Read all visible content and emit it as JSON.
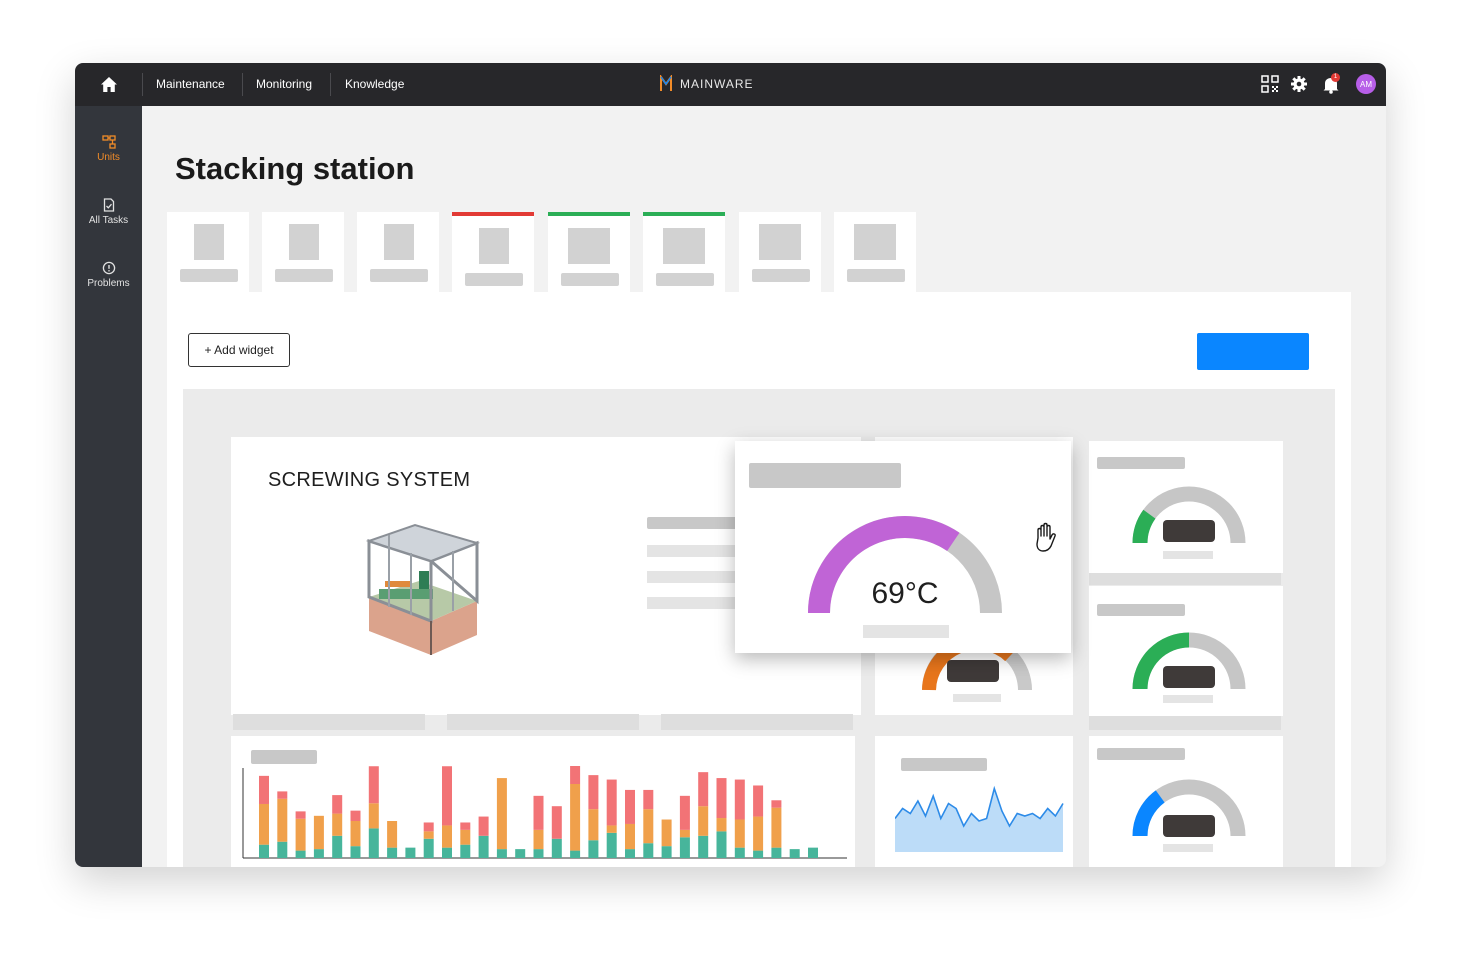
{
  "topbar": {
    "nav": [
      "Maintenance",
      "Monitoring",
      "Knowledge"
    ],
    "brand": "MAINWARE",
    "avatar_initials": "AM",
    "notification_count": "1",
    "icons": [
      "home-icon",
      "qr-code-icon",
      "gear-icon",
      "bell-icon"
    ]
  },
  "sidebar": {
    "items": [
      {
        "label": "Units",
        "icon": "units-icon",
        "active": true
      },
      {
        "label": "All Tasks",
        "icon": "task-file-icon",
        "active": false
      },
      {
        "label": "Problems",
        "icon": "alert-circle-icon",
        "active": false
      }
    ]
  },
  "page": {
    "title": "Stacking station",
    "add_widget_label": "+ Add widget",
    "tabs": [
      {
        "status": "none"
      },
      {
        "status": "none"
      },
      {
        "status": "none"
      },
      {
        "status": "error"
      },
      {
        "status": "ok"
      },
      {
        "status": "ok"
      },
      {
        "status": "none"
      },
      {
        "status": "none"
      }
    ]
  },
  "widgets": {
    "system_name": "SCREWING SYSTEM",
    "temperature_value": "69°C",
    "temperature_fraction": 0.69,
    "cursor": "grab-hand-icon",
    "small_gauges": [
      {
        "fraction": 0.2,
        "color": "#2bae56"
      },
      {
        "fraction": 0.5,
        "color": "#2bae56"
      },
      {
        "fraction": 0.3,
        "color": "#0a86ff"
      }
    ],
    "colors": {
      "accent": "#f28c28",
      "gauge_purple": "#c064d6",
      "gauge_orange": "#e8761c",
      "bar_teal": "#47b59b",
      "bar_orange": "#f0a04b",
      "bar_red": "#f27376",
      "line_blue": "#2d8be8",
      "primary_blue": "#0a86ff"
    },
    "stacked_bars": [
      [
        0.18,
        0.55,
        0.38
      ],
      [
        0.22,
        0.58,
        0.1
      ],
      [
        0.1,
        0.43,
        0.1
      ],
      [
        0.12,
        0.45,
        0.0
      ],
      [
        0.3,
        0.3,
        0.25
      ],
      [
        0.16,
        0.34,
        0.14
      ],
      [
        0.4,
        0.34,
        0.5
      ],
      [
        0.14,
        0.36,
        0.0
      ],
      [
        0.14,
        0.0,
        0.0
      ],
      [
        0.26,
        0.1,
        0.12
      ],
      [
        0.14,
        0.3,
        0.8
      ],
      [
        0.18,
        0.2,
        0.1
      ],
      [
        0.3,
        0.0,
        0.26
      ],
      [
        0.12,
        0.96,
        0.0
      ],
      [
        0.12,
        0.0,
        0.0
      ],
      [
        0.12,
        0.26,
        0.46
      ],
      [
        0.26,
        0.0,
        0.44
      ],
      [
        0.1,
        0.9,
        0.5
      ],
      [
        0.24,
        0.42,
        0.46
      ],
      [
        0.34,
        0.1,
        0.62
      ],
      [
        0.12,
        0.34,
        0.46
      ],
      [
        0.2,
        0.46,
        0.26
      ],
      [
        0.16,
        0.36,
        0.0
      ],
      [
        0.28,
        0.1,
        0.46
      ],
      [
        0.3,
        0.4,
        0.46
      ],
      [
        0.36,
        0.18,
        0.54
      ],
      [
        0.14,
        0.38,
        0.54
      ],
      [
        0.1,
        0.46,
        0.42
      ],
      [
        0.14,
        0.54,
        0.1
      ],
      [
        0.12,
        0.0,
        0.0
      ],
      [
        0.14,
        0.0,
        0.0
      ]
    ],
    "line_series": [
      0.35,
      0.55,
      0.45,
      0.7,
      0.4,
      0.8,
      0.35,
      0.65,
      0.55,
      0.2,
      0.45,
      0.3,
      0.35,
      0.95,
      0.5,
      0.2,
      0.45,
      0.4,
      0.45,
      0.35,
      0.55,
      0.4,
      0.65
    ]
  }
}
